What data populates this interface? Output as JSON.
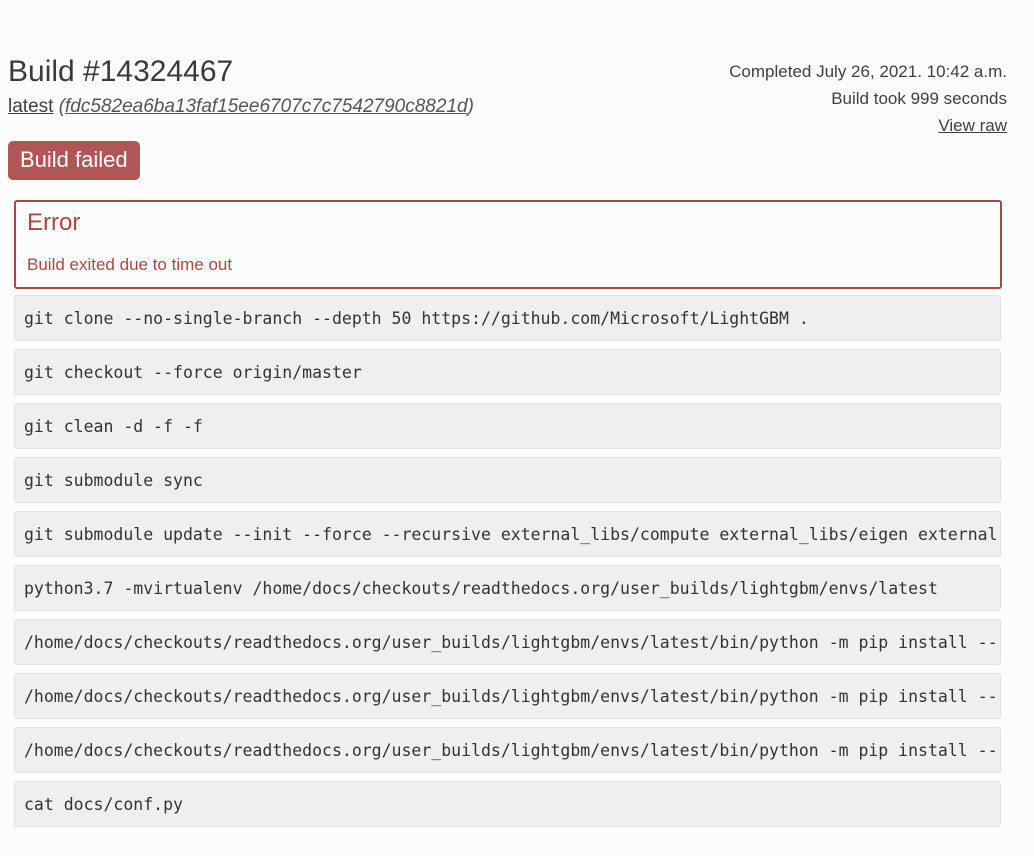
{
  "build": {
    "title": "Build #14324467",
    "version_label": "latest",
    "commit_hash": "fdc582ea6ba13faf15ee6707c7c7542790c8821d",
    "completed": "Completed July 26, 2021. 10:42 a.m.",
    "duration": "Build took 999 seconds",
    "view_raw_label": "View raw",
    "status": "Build failed"
  },
  "error": {
    "title": "Error",
    "message": "Build exited due to time out"
  },
  "commands": [
    "git clone --no-single-branch --depth 50 https://github.com/Microsoft/LightGBM .",
    "git checkout --force origin/master",
    "git clean -d -f -f",
    "git submodule sync",
    "git submodule update --init --force --recursive external_libs/compute external_libs/eigen external",
    "python3.7 -mvirtualenv /home/docs/checkouts/readthedocs.org/user_builds/lightgbm/envs/latest",
    "/home/docs/checkouts/readthedocs.org/user_builds/lightgbm/envs/latest/bin/python -m pip install --",
    "/home/docs/checkouts/readthedocs.org/user_builds/lightgbm/envs/latest/bin/python -m pip install --",
    "/home/docs/checkouts/readthedocs.org/user_builds/lightgbm/envs/latest/bin/python -m pip install --",
    "cat docs/conf.py"
  ],
  "colors": {
    "status_failed": "#b05656",
    "error_accent": "#a94848",
    "command_bg": "#efefef"
  }
}
